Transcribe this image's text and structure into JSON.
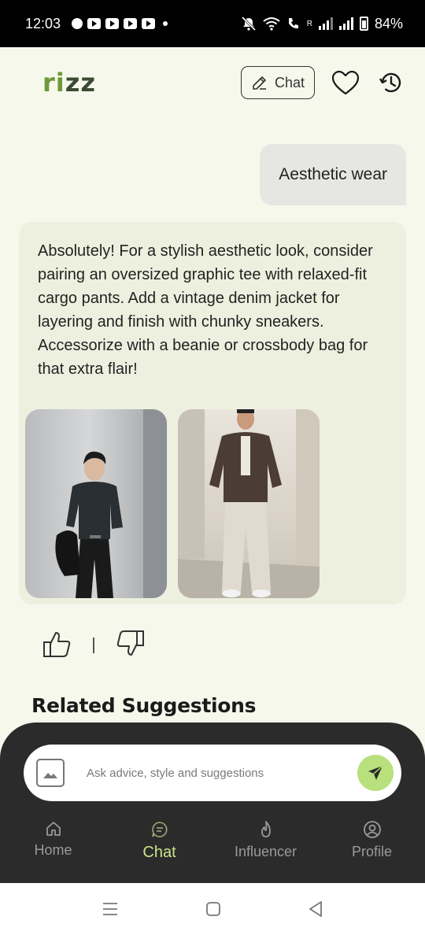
{
  "status_bar": {
    "time": "12:03",
    "battery": "84%",
    "network_label": "R"
  },
  "header": {
    "logo_part1": "ri",
    "logo_part2": "zz",
    "chat_button_label": "Chat",
    "icons": [
      "edit-icon",
      "heart-icon",
      "history-icon"
    ]
  },
  "conversation": {
    "user_message": "Aesthetic wear",
    "bot_message": "Absolutely! For a stylish aesthetic look, consider pairing an oversized graphic tee with relaxed-fit cargo pants. Add a vintage denim jacket for layering and finish with chunky sneakers. Accessorize with a beanie or crossbody bag for that extra flair!"
  },
  "feedback": {
    "icons": [
      "thumbs-up-icon",
      "thumbs-down-icon"
    ]
  },
  "related_suggestions_title": "Related Suggestions",
  "input": {
    "placeholder": "Ask advice, style and suggestions"
  },
  "bottom_nav": {
    "items": [
      {
        "label": "Home",
        "icon": "home-icon",
        "active": false
      },
      {
        "label": "Chat",
        "icon": "chat-icon",
        "active": true
      },
      {
        "label": "Influencer",
        "icon": "flame-icon",
        "active": false
      },
      {
        "label": "Profile",
        "icon": "profile-icon",
        "active": false
      }
    ]
  },
  "colors": {
    "background": "#f7f8ec",
    "bot_card": "#eef0df",
    "user_bubble": "#e6e7e3",
    "accent_green": "#b8e07c",
    "nav_active": "#cde38a",
    "bottom_panel": "#2b2b2b"
  }
}
